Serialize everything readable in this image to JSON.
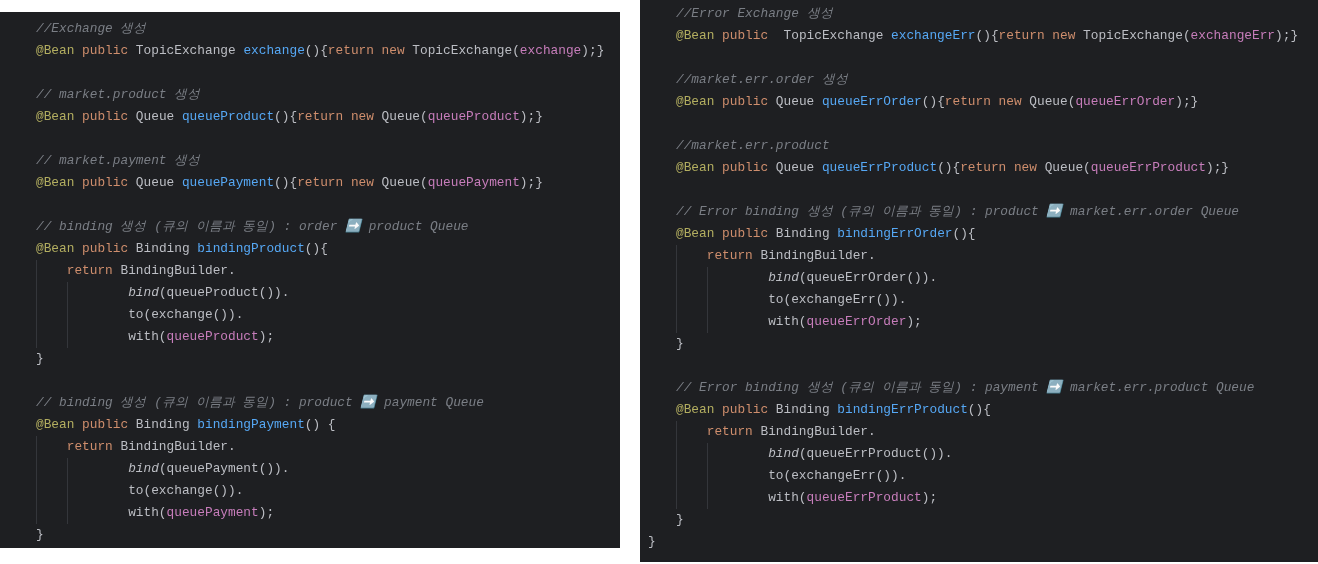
{
  "panels": [
    {
      "lines": [
        {
          "kind": "code",
          "tokens": [
            {
              "kind": "comment",
              "text": "//Exchange 생성"
            }
          ]
        },
        {
          "kind": "code",
          "tokens": [
            {
              "kind": "annotation",
              "text": "@Bean"
            },
            {
              "kind": "keyword",
              "text": " public"
            },
            {
              "kind": "plain",
              "text": " TopicExchange "
            },
            {
              "kind": "method",
              "text": "exchange"
            },
            {
              "kind": "plain",
              "text": "(){"
            },
            {
              "kind": "keyword",
              "text": "return new"
            },
            {
              "kind": "plain",
              "text": " TopicExchange("
            },
            {
              "kind": "field",
              "text": "exchange"
            },
            {
              "kind": "plain",
              "text": ");}"
            }
          ]
        },
        {
          "kind": "blank"
        },
        {
          "kind": "code",
          "tokens": [
            {
              "kind": "comment",
              "text": "// market.product 생성"
            }
          ]
        },
        {
          "kind": "code",
          "tokens": [
            {
              "kind": "annotation",
              "text": "@Bean"
            },
            {
              "kind": "keyword",
              "text": " public"
            },
            {
              "kind": "plain",
              "text": " Queue "
            },
            {
              "kind": "method",
              "text": "queueProduct"
            },
            {
              "kind": "plain",
              "text": "(){"
            },
            {
              "kind": "keyword",
              "text": "return new"
            },
            {
              "kind": "plain",
              "text": " Queue("
            },
            {
              "kind": "field",
              "text": "queueProduct"
            },
            {
              "kind": "plain",
              "text": ");}"
            }
          ]
        },
        {
          "kind": "blank"
        },
        {
          "kind": "code",
          "tokens": [
            {
              "kind": "comment",
              "text": "// market.payment 생성"
            }
          ]
        },
        {
          "kind": "code",
          "tokens": [
            {
              "kind": "annotation",
              "text": "@Bean"
            },
            {
              "kind": "keyword",
              "text": " public"
            },
            {
              "kind": "plain",
              "text": " Queue "
            },
            {
              "kind": "method",
              "text": "queuePayment"
            },
            {
              "kind": "plain",
              "text": "(){"
            },
            {
              "kind": "keyword",
              "text": "return new"
            },
            {
              "kind": "plain",
              "text": " Queue("
            },
            {
              "kind": "field",
              "text": "queuePayment"
            },
            {
              "kind": "plain",
              "text": ");}"
            }
          ]
        },
        {
          "kind": "blank"
        },
        {
          "kind": "code",
          "tokens": [
            {
              "kind": "comment",
              "text": "// binding 생성 (큐의 이름과 동일) : order ➡️ product Queue"
            }
          ]
        },
        {
          "kind": "code",
          "tokens": [
            {
              "kind": "annotation",
              "text": "@Bean"
            },
            {
              "kind": "keyword",
              "text": " public"
            },
            {
              "kind": "plain",
              "text": " Binding "
            },
            {
              "kind": "method",
              "text": "bindingProduct"
            },
            {
              "kind": "plain",
              "text": "(){"
            }
          ],
          "children": [
            {
              "kind": "code",
              "tokens": [
                {
                  "kind": "keyword",
                  "text": "return"
                },
                {
                  "kind": "plain",
                  "text": " BindingBuilder."
                }
              ],
              "children": [
                {
                  "kind": "code",
                  "tokens": [
                    {
                      "kind": "call",
                      "text": "bind"
                    },
                    {
                      "kind": "plain",
                      "text": "(queueProduct())."
                    }
                  ]
                },
                {
                  "kind": "code",
                  "tokens": [
                    {
                      "kind": "plain",
                      "text": "to(exchange())."
                    }
                  ]
                },
                {
                  "kind": "code",
                  "tokens": [
                    {
                      "kind": "plain",
                      "text": "with("
                    },
                    {
                      "kind": "field",
                      "text": "queueProduct"
                    },
                    {
                      "kind": "plain",
                      "text": ");"
                    }
                  ]
                }
              ]
            }
          ]
        },
        {
          "kind": "code",
          "tokens": [
            {
              "kind": "plain",
              "text": "}"
            }
          ]
        },
        {
          "kind": "blank"
        },
        {
          "kind": "code",
          "tokens": [
            {
              "kind": "comment",
              "text": "// binding 생성 (큐의 이름과 동일) : product ➡️ payment Queue"
            }
          ]
        },
        {
          "kind": "code",
          "tokens": [
            {
              "kind": "annotation",
              "text": "@Bean"
            },
            {
              "kind": "keyword",
              "text": " public"
            },
            {
              "kind": "plain",
              "text": " Binding "
            },
            {
              "kind": "method",
              "text": "bindingPayment"
            },
            {
              "kind": "plain",
              "text": "() {"
            }
          ],
          "children": [
            {
              "kind": "code",
              "tokens": [
                {
                  "kind": "keyword",
                  "text": "return"
                },
                {
                  "kind": "plain",
                  "text": " BindingBuilder."
                }
              ],
              "children": [
                {
                  "kind": "code",
                  "tokens": [
                    {
                      "kind": "call",
                      "text": "bind"
                    },
                    {
                      "kind": "plain",
                      "text": "(queuePayment())."
                    }
                  ]
                },
                {
                  "kind": "code",
                  "tokens": [
                    {
                      "kind": "plain",
                      "text": "to(exchange())."
                    }
                  ]
                },
                {
                  "kind": "code",
                  "tokens": [
                    {
                      "kind": "plain",
                      "text": "with("
                    },
                    {
                      "kind": "field",
                      "text": "queuePayment"
                    },
                    {
                      "kind": "plain",
                      "text": ");"
                    }
                  ]
                }
              ]
            }
          ]
        },
        {
          "kind": "code",
          "tokens": [
            {
              "kind": "plain",
              "text": "}"
            }
          ]
        }
      ]
    },
    {
      "lines": [
        {
          "kind": "code",
          "tokens": [
            {
              "kind": "comment",
              "text": "//Error Exchange 생성"
            }
          ]
        },
        {
          "kind": "code",
          "tokens": [
            {
              "kind": "annotation",
              "text": "@Bean"
            },
            {
              "kind": "keyword",
              "text": " public"
            },
            {
              "kind": "plain",
              "text": "  TopicExchange "
            },
            {
              "kind": "method",
              "text": "exchangeErr"
            },
            {
              "kind": "plain",
              "text": "(){"
            },
            {
              "kind": "keyword",
              "text": "return new"
            },
            {
              "kind": "plain",
              "text": " TopicExchange("
            },
            {
              "kind": "field",
              "text": "exchangeErr"
            },
            {
              "kind": "plain",
              "text": ");}"
            }
          ]
        },
        {
          "kind": "blank"
        },
        {
          "kind": "code",
          "tokens": [
            {
              "kind": "comment",
              "text": "//market.err.order 생성"
            }
          ]
        },
        {
          "kind": "code",
          "tokens": [
            {
              "kind": "annotation",
              "text": "@Bean"
            },
            {
              "kind": "keyword",
              "text": " public"
            },
            {
              "kind": "plain",
              "text": " Queue "
            },
            {
              "kind": "method",
              "text": "queueErrOrder"
            },
            {
              "kind": "plain",
              "text": "(){"
            },
            {
              "kind": "keyword",
              "text": "return new"
            },
            {
              "kind": "plain",
              "text": " Queue("
            },
            {
              "kind": "field",
              "text": "queueErrOrder"
            },
            {
              "kind": "plain",
              "text": ");}"
            }
          ]
        },
        {
          "kind": "blank"
        },
        {
          "kind": "code",
          "tokens": [
            {
              "kind": "comment",
              "text": "//market.err.product"
            }
          ]
        },
        {
          "kind": "code",
          "tokens": [
            {
              "kind": "annotation",
              "text": "@Bean"
            },
            {
              "kind": "keyword",
              "text": " public"
            },
            {
              "kind": "plain",
              "text": " Queue "
            },
            {
              "kind": "method",
              "text": "queueErrProduct"
            },
            {
              "kind": "plain",
              "text": "(){"
            },
            {
              "kind": "keyword",
              "text": "return new"
            },
            {
              "kind": "plain",
              "text": " Queue("
            },
            {
              "kind": "field",
              "text": "queueErrProduct"
            },
            {
              "kind": "plain",
              "text": ");}"
            }
          ]
        },
        {
          "kind": "blank"
        },
        {
          "kind": "code",
          "tokens": [
            {
              "kind": "comment",
              "text": "// Error binding 생성 (큐의 이름과 동일) : product ➡️ market.err.order Queue"
            }
          ]
        },
        {
          "kind": "code",
          "tokens": [
            {
              "kind": "annotation",
              "text": "@Bean"
            },
            {
              "kind": "keyword",
              "text": " public"
            },
            {
              "kind": "plain",
              "text": " Binding "
            },
            {
              "kind": "method",
              "text": "bindingErrOrder"
            },
            {
              "kind": "plain",
              "text": "(){"
            }
          ],
          "children": [
            {
              "kind": "code",
              "tokens": [
                {
                  "kind": "keyword",
                  "text": "return"
                },
                {
                  "kind": "plain",
                  "text": " BindingBuilder."
                }
              ],
              "children": [
                {
                  "kind": "code",
                  "tokens": [
                    {
                      "kind": "call",
                      "text": "bind"
                    },
                    {
                      "kind": "plain",
                      "text": "(queueErrOrder())."
                    }
                  ]
                },
                {
                  "kind": "code",
                  "tokens": [
                    {
                      "kind": "plain",
                      "text": "to(exchangeErr())."
                    }
                  ]
                },
                {
                  "kind": "code",
                  "tokens": [
                    {
                      "kind": "plain",
                      "text": "with("
                    },
                    {
                      "kind": "field",
                      "text": "queueErrOrder"
                    },
                    {
                      "kind": "plain",
                      "text": ");"
                    }
                  ]
                }
              ]
            }
          ]
        },
        {
          "kind": "code",
          "tokens": [
            {
              "kind": "plain",
              "text": "}"
            }
          ]
        },
        {
          "kind": "blank"
        },
        {
          "kind": "code",
          "tokens": [
            {
              "kind": "comment",
              "text": "// Error binding 생성 (큐의 이름과 동일) : payment ➡️ market.err.product Queue"
            }
          ]
        },
        {
          "kind": "code",
          "tokens": [
            {
              "kind": "annotation",
              "text": "@Bean"
            },
            {
              "kind": "keyword",
              "text": " public"
            },
            {
              "kind": "plain",
              "text": " Binding "
            },
            {
              "kind": "method",
              "text": "bindingErrProduct"
            },
            {
              "kind": "plain",
              "text": "(){"
            }
          ],
          "children": [
            {
              "kind": "code",
              "tokens": [
                {
                  "kind": "keyword",
                  "text": "return"
                },
                {
                  "kind": "plain",
                  "text": " BindingBuilder."
                }
              ],
              "children": [
                {
                  "kind": "code",
                  "tokens": [
                    {
                      "kind": "call",
                      "text": "bind"
                    },
                    {
                      "kind": "plain",
                      "text": "(queueErrProduct())."
                    }
                  ]
                },
                {
                  "kind": "code",
                  "tokens": [
                    {
                      "kind": "plain",
                      "text": "to(exchangeErr())."
                    }
                  ]
                },
                {
                  "kind": "code",
                  "tokens": [
                    {
                      "kind": "plain",
                      "text": "with("
                    },
                    {
                      "kind": "field",
                      "text": "queueErrProduct"
                    },
                    {
                      "kind": "plain",
                      "text": ");"
                    }
                  ]
                }
              ]
            }
          ]
        },
        {
          "kind": "code",
          "tokens": [
            {
              "kind": "plain",
              "text": "}"
            }
          ]
        }
      ],
      "closing_brace": "}"
    }
  ]
}
